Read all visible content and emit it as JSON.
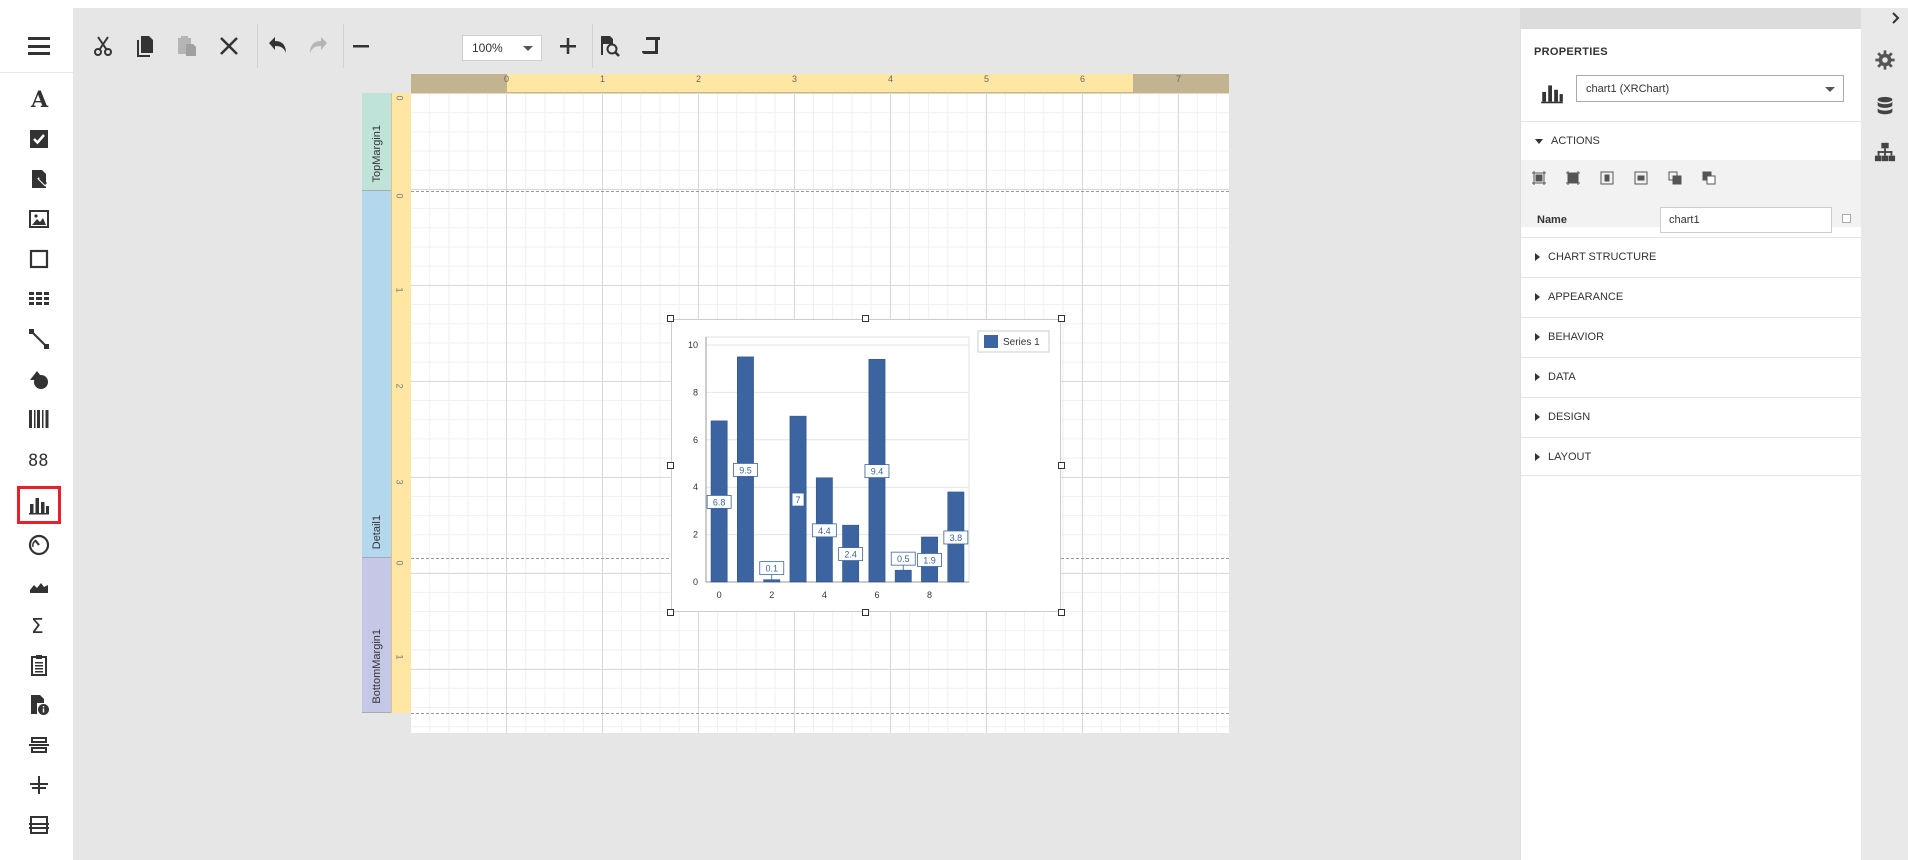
{
  "toolbar": {
    "zoom_value": "100%"
  },
  "ruler": {
    "ticks": [
      "0",
      "1",
      "2",
      "3",
      "4",
      "5",
      "6",
      "7"
    ]
  },
  "bands": {
    "top_margin": "TopMargin1",
    "detail": "Detail1",
    "bottom_margin": "BottomMargin1",
    "top_margin_ticks": [
      "0"
    ],
    "detail_ticks": [
      "0",
      "1",
      "2",
      "3"
    ],
    "bottom_margin_ticks": [
      "0",
      "1"
    ]
  },
  "toolbox": {
    "items": [
      {
        "icon": "label-icon"
      },
      {
        "icon": "checkbox-icon"
      },
      {
        "icon": "rich-text-icon"
      },
      {
        "icon": "picture-box-icon"
      },
      {
        "icon": "panel-icon"
      },
      {
        "icon": "table-icon"
      },
      {
        "icon": "line-icon"
      },
      {
        "icon": "shape-icon"
      },
      {
        "icon": "barcode-icon"
      },
      {
        "icon": "character-comb-icon"
      },
      {
        "icon": "chart-icon"
      },
      {
        "icon": "gauge-icon"
      },
      {
        "icon": "sparkline-icon"
      },
      {
        "icon": "summary-icon"
      },
      {
        "icon": "subreport-icon"
      },
      {
        "icon": "page-info-icon"
      },
      {
        "icon": "page-break-icon"
      },
      {
        "icon": "cross-band-line-icon"
      },
      {
        "icon": "cross-band-box-icon"
      }
    ],
    "selected": "chart-icon"
  },
  "properties": {
    "title": "PROPERTIES",
    "component": "chart1 (XRChart)",
    "sections": {
      "actions": "ACTIONS",
      "chart_structure": "CHART STRUCTURE",
      "appearance": "APPEARANCE",
      "behavior": "BEHAVIOR",
      "data": "DATA",
      "design": "DESIGN",
      "layout": "LAYOUT"
    },
    "name_label": "Name",
    "name_value": "chart1"
  },
  "colors": {
    "bar": "#3b64a0",
    "ruler": "#ffe6a2",
    "top_margin_band": "#bfe3d9",
    "detail_band": "#b3d7ed",
    "bottom_margin_band": "#c5c7e6",
    "selection": "#e8202a"
  },
  "chart_data": {
    "type": "bar",
    "x": [
      0,
      1,
      2,
      3,
      4,
      5,
      6,
      7,
      8,
      9
    ],
    "series": [
      {
        "name": "Series 1",
        "values": [
          6.8,
          9.5,
          0.1,
          7,
          4.4,
          2.4,
          9.4,
          0.5,
          1.9,
          3.8
        ]
      }
    ],
    "data_labels": [
      "6.8",
      "9.5",
      "0.1",
      "7",
      "4.4",
      "2.4",
      "9.4",
      "0.5",
      "1.9",
      "3.8"
    ],
    "x_ticks": [
      "0",
      "2",
      "4",
      "6",
      "8"
    ],
    "y_ticks": [
      "0",
      "2",
      "4",
      "6",
      "8",
      "10"
    ],
    "ylim": [
      0,
      10
    ],
    "xlim": [
      -0.5,
      9.5
    ],
    "legend": "top-right",
    "grid": true
  }
}
